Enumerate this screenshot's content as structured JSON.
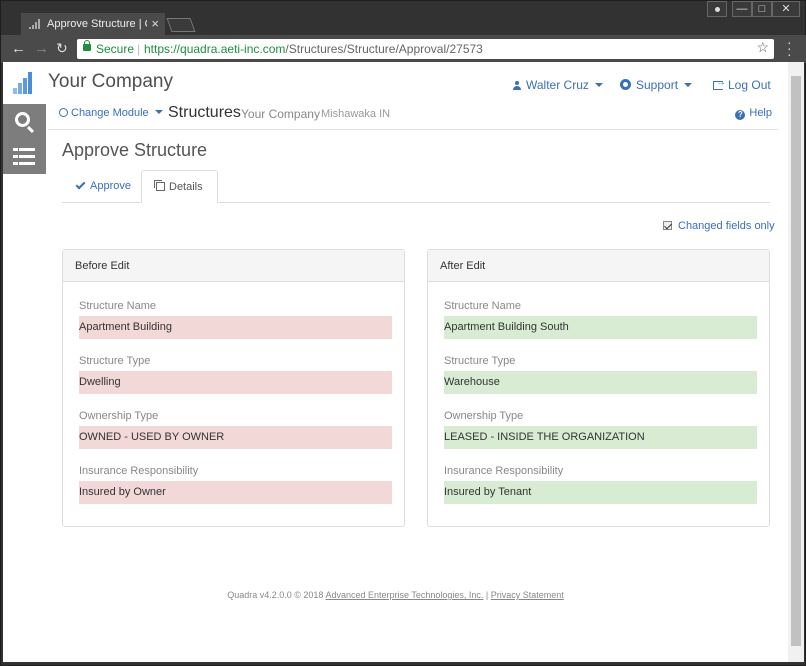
{
  "browser": {
    "tab_title": "Approve Structure | Quadra",
    "close_glyph": "×",
    "url_host": "https://quadra.aeti-inc.com",
    "url_path": "/Structures/Structure/Approval/27573",
    "secure_label": "Secure",
    "window_buttons": [
      "—",
      "□",
      "✕"
    ]
  },
  "header": {
    "brand": "Your Company",
    "user": "Walter Cruz",
    "support": "Support",
    "logout": "Log Out"
  },
  "subnav": {
    "change_module": "Change Module",
    "module_title": "Structures",
    "company": "Your Company",
    "location": "Mishawaka IN",
    "help": "Help"
  },
  "page": {
    "title": "Approve Structure",
    "tabs": [
      {
        "label": "Approve",
        "active": false
      },
      {
        "label": "Details",
        "active": true
      }
    ],
    "changed_only_label": "Changed fields only",
    "changed_only_checked": true
  },
  "before": {
    "heading": "Before Edit",
    "fields": [
      {
        "label": "Structure Name",
        "value": "Apartment Building"
      },
      {
        "label": "Structure Type",
        "value": "Dwelling"
      },
      {
        "label": "Ownership Type",
        "value": "OWNED - USED BY OWNER"
      },
      {
        "label": "Insurance Responsibility",
        "value": "Insured by Owner"
      }
    ]
  },
  "after": {
    "heading": "After Edit",
    "fields": [
      {
        "label": "Structure Name",
        "value": "Apartment Building South"
      },
      {
        "label": "Structure Type",
        "value": "Warehouse"
      },
      {
        "label": "Ownership Type",
        "value": "LEASED - INSIDE THE ORGANIZATION"
      },
      {
        "label": "Insurance Responsibility",
        "value": "Insured by Tenant"
      }
    ]
  },
  "footer": {
    "version": "Quadra v4.2.0.0 © 2018",
    "company_link": "Advanced Enterprise Technologies, Inc.",
    "divider": "|",
    "privacy_link": "Privacy Statement"
  },
  "colors": {
    "accent": "#3b6fb6",
    "before_bg": "#f3d8d8",
    "after_bg": "#d8ecd3"
  }
}
